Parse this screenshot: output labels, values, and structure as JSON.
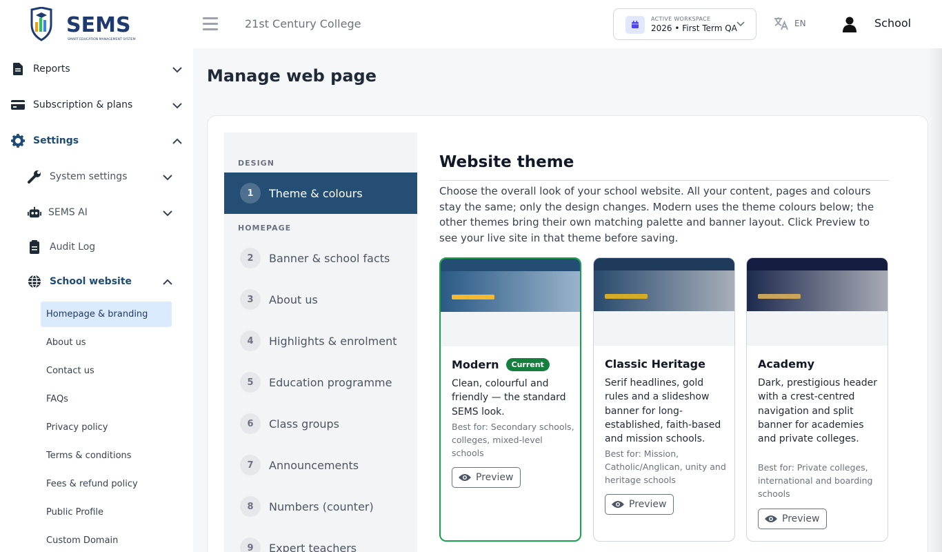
{
  "brand": {
    "name": "SEMS",
    "tagline": "SMART EDUCATION MANAGEMENT SYSTEM"
  },
  "sidebar": {
    "items": [
      {
        "label": "Reports",
        "icon": "file-icon"
      },
      {
        "label": "Subscription & plans",
        "icon": "credit-card-icon"
      },
      {
        "label": "Settings",
        "icon": "gear-icon"
      },
      {
        "label": "System settings",
        "icon": "wrench-icon"
      },
      {
        "label": "SEMS AI",
        "icon": "robot-icon"
      },
      {
        "label": "Audit Log",
        "icon": "clipboard-icon"
      },
      {
        "label": "School website",
        "icon": "globe-icon"
      }
    ],
    "sub_items": [
      "Homepage & branding",
      "About us",
      "Contact us",
      "FAQs",
      "Privacy policy",
      "Terms & conditions",
      "Fees & refund policy",
      "Public Profile",
      "Custom Domain"
    ]
  },
  "header": {
    "college": "21st Century College",
    "workspace_label": "ACTIVE WORKSPACE",
    "workspace_value": "2026 • First Term QA",
    "language": "EN",
    "user": "School"
  },
  "page": {
    "title": "Manage web page"
  },
  "steps": {
    "design_label": "DESIGN",
    "homepage_label": "HOMEPAGE",
    "items": [
      {
        "num": "1",
        "label": "Theme & colours"
      },
      {
        "num": "2",
        "label": "Banner & school facts"
      },
      {
        "num": "3",
        "label": "About us"
      },
      {
        "num": "4",
        "label": "Highlights & enrolment"
      },
      {
        "num": "5",
        "label": "Education programme"
      },
      {
        "num": "6",
        "label": "Class groups"
      },
      {
        "num": "7",
        "label": "Announcements"
      },
      {
        "num": "8",
        "label": "Numbers (counter)"
      },
      {
        "num": "9",
        "label": "Expert teachers"
      }
    ]
  },
  "theme_section": {
    "title": "Website theme",
    "description": "Choose the overall look of your school website. All your content, pages and colours stay the same; only the design changes. Modern uses the theme colours below; the other themes bring their own matching palette and banner layout. Click Preview to see your live site in that theme before saving.",
    "current_badge": "Current",
    "preview_label": "Preview",
    "themes": [
      {
        "name": "Modern",
        "description": "Clean, colourful and friendly — the standard SEMS look.",
        "best_for": "Best for: Secondary schools, colleges, mixed-level schools",
        "colors": {
          "top": "#234d72",
          "banner_from": "#2a5a85",
          "banner_to": "#9ab3cb",
          "accent": "#f5b82e"
        }
      },
      {
        "name": "Classic Heritage",
        "description": "Serif headlines, gold rules and a slideshow banner for long-established, faith-based and mission schools.",
        "best_for": "Best for: Mission, Catholic/Anglican, unity and heritage schools",
        "colors": {
          "top": "#1f3b5c",
          "banner_from": "#294a6e",
          "banner_to": "#a7afb9",
          "accent": "#d4ac28"
        }
      },
      {
        "name": "Academy",
        "description": "Dark, prestigious header with a crest-centred navigation and split banner for academies and private colleges.",
        "best_for": "Best for: Private colleges, international and boarding schools",
        "colors": {
          "top": "#141d3f",
          "banner_from": "#1d2a4e",
          "banner_to": "#a9abb5",
          "accent": "#c9a45a"
        }
      }
    ]
  }
}
